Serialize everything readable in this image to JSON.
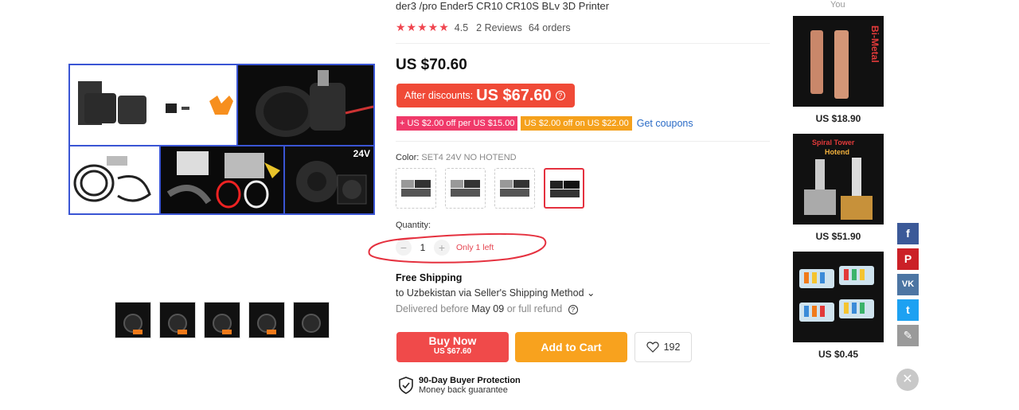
{
  "product": {
    "title": "der3 /pro Ender5 CR10 CR10S BLv 3D Printer",
    "stars": "★★★★★",
    "rating": "4.5",
    "reviews": "2 Reviews",
    "orders": "64 orders",
    "price": "US $70.60",
    "discount_label": "After discounts:",
    "discount_price": "US $67.60",
    "coupon1": "+ US $2.00 off per US $15.00",
    "coupon2": "US $2.00 off on US $22.00",
    "get_coupons": "Get coupons",
    "color_label": "Color:",
    "color_value": "SET4 24V NO HOTEND",
    "image_badge": "24V"
  },
  "quantity": {
    "label": "Quantity:",
    "minus": "−",
    "value": "1",
    "plus": "+",
    "stock_note": "Only 1 left"
  },
  "shipping": {
    "title": "Free Shipping",
    "destination": "to Uzbekistan via Seller's Shipping Method ⌄",
    "delivered_prefix": "Delivered before",
    "delivered_date": "May 09",
    "delivered_suffix": "or full refund"
  },
  "actions": {
    "buy_now": "Buy Now",
    "buy_now_price": "US $67.60",
    "add_to_cart": "Add to Cart",
    "wishlist_count": "192"
  },
  "protection": {
    "title": "90-Day Buyer Protection",
    "subtitle": "Money back guarantee"
  },
  "recommendations": {
    "header": "You",
    "items": [
      {
        "price": "US $18.90",
        "tag": "Bi-Metal"
      },
      {
        "price": "US $51.90",
        "tag": "Spiral Tower",
        "sub": "Hotend"
      },
      {
        "price": "US $0.45"
      }
    ]
  },
  "social": {
    "facebook": "f",
    "pinterest": "P",
    "vk": "VK",
    "twitter": "t",
    "edit": "✎",
    "close": "✕"
  },
  "colors": {
    "accent_red": "#f04a37",
    "cart_orange": "#f8a21e",
    "link_blue": "#2a6bc6",
    "annotation_red": "#e5313f"
  }
}
